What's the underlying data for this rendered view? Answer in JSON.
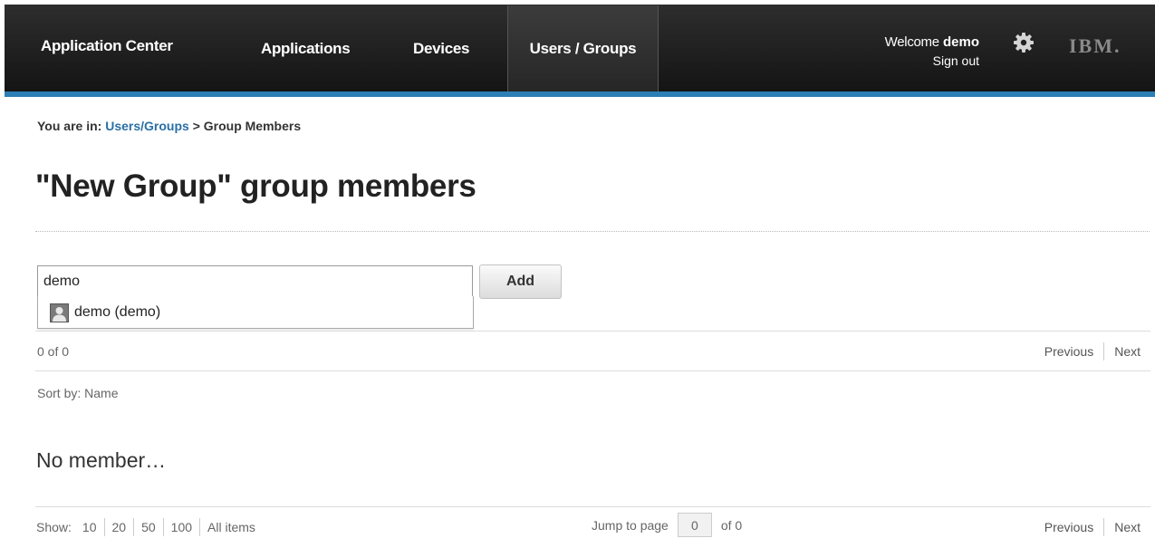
{
  "nav": {
    "brand": "Application Center",
    "applications": "Applications",
    "devices": "Devices",
    "users_groups": "Users / Groups",
    "welcome_label": "Welcome",
    "username": "demo",
    "sign_out": "Sign out",
    "settings_icon": "gear-icon",
    "logo": "IBM.",
    "accent_color": "#2b7fb5"
  },
  "breadcrumb": {
    "prefix": "You are in:",
    "link": "Users/Groups",
    "separator": ">",
    "current": "Group Members"
  },
  "page": {
    "title": "\"New Group\" group members"
  },
  "add_member": {
    "input_value": "demo",
    "button_label": "Add",
    "suggestions": [
      {
        "icon": "user-icon",
        "label": "demo (demo)"
      }
    ]
  },
  "list": {
    "count": "0 of 0",
    "previous": "Previous",
    "next": "Next",
    "sort_by": "Sort by: Name",
    "empty_message": "No member…"
  },
  "footer": {
    "show_label": "Show:",
    "page_sizes": [
      "10",
      "20",
      "50",
      "100",
      "All items"
    ],
    "jump_label": "Jump to page",
    "page_value": "0",
    "of_pages": "of 0",
    "previous": "Previous",
    "next": "Next"
  }
}
